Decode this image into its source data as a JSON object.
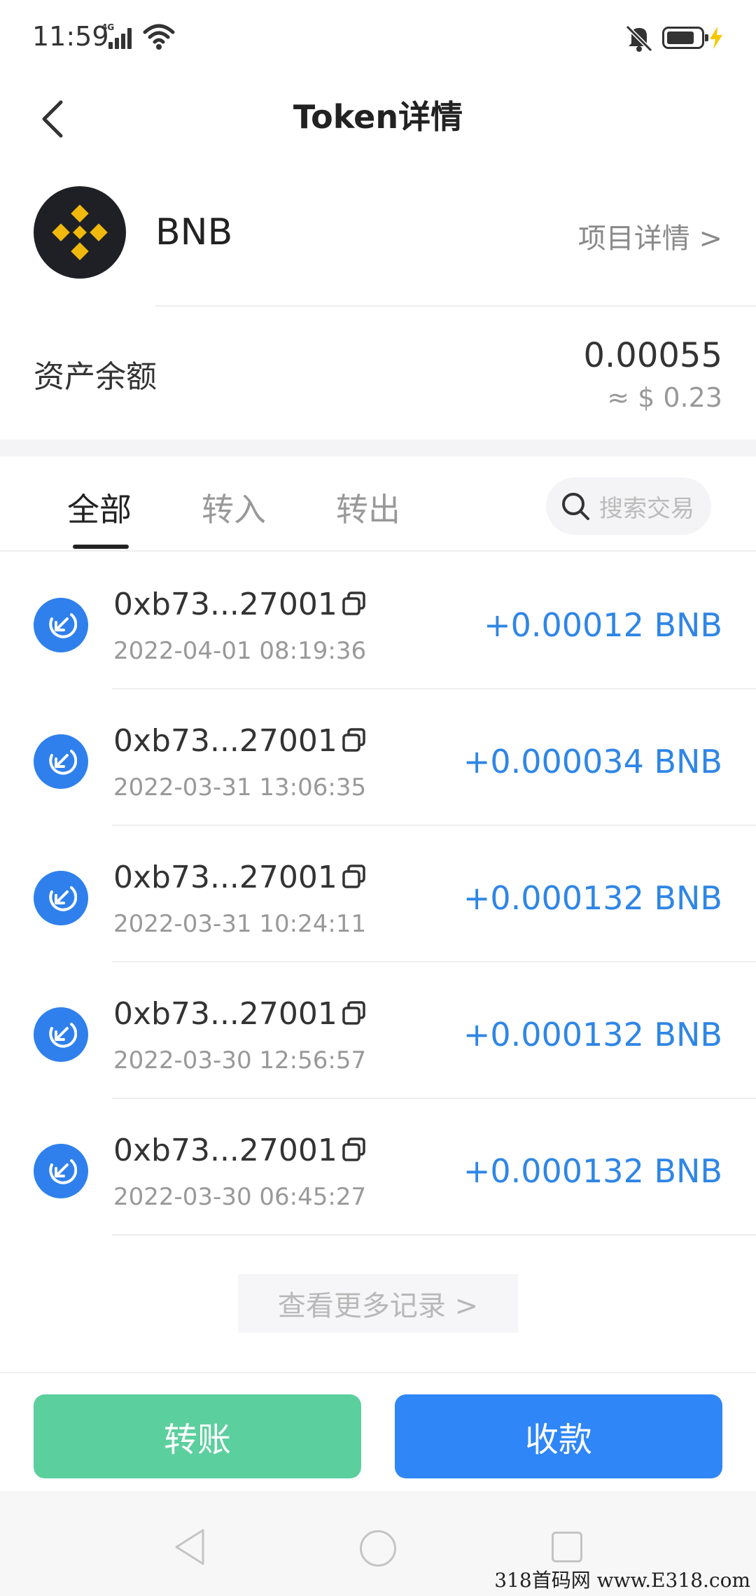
{
  "status_bar": {
    "time": "11:59",
    "network": "4G",
    "icons": [
      "signal-icon",
      "wifi-icon",
      "silent-bell-icon",
      "battery-icon",
      "charging-icon"
    ]
  },
  "nav": {
    "title": "Token详情",
    "back_icon": "chevron-left-icon"
  },
  "token": {
    "name": "BNB",
    "project_link": "项目详情 >",
    "logo_colors": {
      "background": "#1e2026",
      "mark": "#f0b90b"
    }
  },
  "balance": {
    "label": "资产余额",
    "amount": "0.00055",
    "usd": "≈ $ 0.23"
  },
  "tabs": {
    "items": [
      {
        "label": "全部",
        "active": true
      },
      {
        "label": "转入",
        "active": false
      },
      {
        "label": "转出",
        "active": false
      }
    ],
    "search_placeholder": "搜索交易"
  },
  "transactions": [
    {
      "hash": "0xb73...27001",
      "time": "2022-04-01 08:19:36",
      "amount": "+0.00012 BNB"
    },
    {
      "hash": "0xb73...27001",
      "time": "2022-03-31 13:06:35",
      "amount": "+0.000034 BNB"
    },
    {
      "hash": "0xb73...27001",
      "time": "2022-03-31 10:24:11",
      "amount": "+0.000132 BNB"
    },
    {
      "hash": "0xb73...27001",
      "time": "2022-03-30 12:56:57",
      "amount": "+0.000132 BNB"
    },
    {
      "hash": "0xb73...27001",
      "time": "2022-03-30 06:45:27",
      "amount": "+0.000132 BNB"
    }
  ],
  "more_records": "查看更多记录 >",
  "actions": {
    "transfer": "转账",
    "receive": "收款"
  },
  "colors": {
    "accent_blue": "#2f86f6",
    "accent_green": "#5ccf9e",
    "incoming_icon": "#2f80ed"
  },
  "watermark": "318首码网 www.E318.com"
}
